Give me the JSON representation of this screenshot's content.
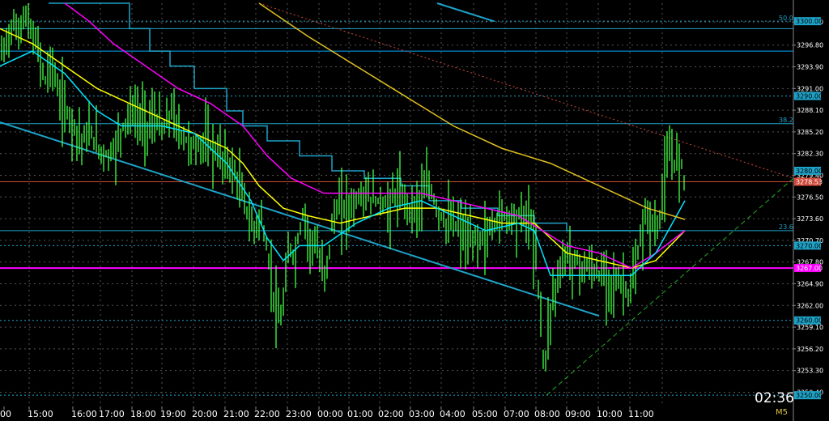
{
  "window": {
    "timeframe": "M5",
    "countdown": "02:36"
  },
  "chart_data": {
    "type": "candlestick",
    "timeframe": "M5",
    "ylim": [
      3248.5,
      3302.4
    ],
    "y_ticks": [
      "3299.90",
      "3296.80",
      "3293.90",
      "3291.00",
      "3288.10",
      "3285.20",
      "3282.30",
      "3279.40",
      "3276.50",
      "3273.60",
      "3270.70",
      "3267.80",
      "3264.90",
      "3262.00",
      "3259.10",
      "3256.20",
      "3253.30",
      "3250.40"
    ],
    "x_ticks": [
      "00",
      "15:00",
      "16:00",
      "17:00",
      "18:00",
      "19:00",
      "20:00",
      "21:00",
      "22:00",
      "23:00",
      "00:00",
      "01:00",
      "02:00",
      "03:00",
      "04:00",
      "05:00",
      "07:00",
      "08:00",
      "09:00",
      "10:00",
      "11:00"
    ],
    "price_tags": [
      {
        "label": "3300.00",
        "value": 3300.0,
        "color": "#1ea3c8"
      },
      {
        "label": "3290.00",
        "value": 3290.0,
        "color": "#1ea3c8"
      },
      {
        "label": "3280.00",
        "value": 3280.0,
        "color": "#1ea3c8"
      },
      {
        "label": "3278.53",
        "value": 3278.53,
        "color": "#d04a3a"
      },
      {
        "label": "3270.00",
        "value": 3270.0,
        "color": "#1ea3c8"
      },
      {
        "label": "3267.00",
        "value": 3267.0,
        "color": "#ff00ff"
      },
      {
        "label": "3260.00",
        "value": 3260.0,
        "color": "#1ea3c8"
      },
      {
        "label": "3250.00",
        "value": 3250.0,
        "color": "#1ea3c8"
      }
    ],
    "fib_labels": [
      {
        "label": "50.0",
        "value": 3299.9
      },
      {
        "label": "38.2",
        "value": 3286.3
      },
      {
        "label": "23.6",
        "value": 3272.0
      }
    ],
    "horizontal_lines": [
      {
        "value": 3300.0,
        "color": "#1ea3c8",
        "style": "dotted"
      },
      {
        "value": 3299.0,
        "color": "#1ea3c8",
        "style": "solid"
      },
      {
        "value": 3296.0,
        "color": "#00aaff",
        "style": "solid"
      },
      {
        "value": 3290.0,
        "color": "#1ea3c8",
        "style": "dotted"
      },
      {
        "value": 3286.3,
        "color": "#1ea3c8",
        "style": "solid"
      },
      {
        "value": 3278.53,
        "color": "#d04a3a",
        "style": "solid"
      },
      {
        "value": 3272.0,
        "color": "#1ea3c8",
        "style": "solid"
      },
      {
        "value": 3270.0,
        "color": "#1ea3c8",
        "style": "dotted"
      },
      {
        "value": 3267.0,
        "color": "#ff00ff",
        "style": "solid"
      },
      {
        "value": 3260.0,
        "color": "#1ea3c8",
        "style": "dotted"
      },
      {
        "value": 3250.0,
        "color": "#1ea3c8",
        "style": "dotted"
      }
    ],
    "price_path": [
      [
        0,
        3295
      ],
      [
        8,
        3297
      ],
      [
        15,
        3300
      ],
      [
        22,
        3298
      ],
      [
        30,
        3301
      ],
      [
        40,
        3298
      ],
      [
        48,
        3296
      ],
      [
        56,
        3292
      ],
      [
        64,
        3295
      ],
      [
        72,
        3290
      ],
      [
        82,
        3288
      ],
      [
        92,
        3286
      ],
      [
        102,
        3284
      ],
      [
        112,
        3285
      ],
      [
        122,
        3283
      ],
      [
        132,
        3282
      ],
      [
        142,
        3283
      ],
      [
        152,
        3286
      ],
      [
        162,
        3288
      ],
      [
        172,
        3287
      ],
      [
        182,
        3286
      ],
      [
        192,
        3287
      ],
      [
        202,
        3285
      ],
      [
        212,
        3288
      ],
      [
        222,
        3285
      ],
      [
        232,
        3284
      ],
      [
        242,
        3283
      ],
      [
        252,
        3284
      ],
      [
        262,
        3283
      ],
      [
        272,
        3282
      ],
      [
        282,
        3281
      ],
      [
        292,
        3279
      ],
      [
        302,
        3276
      ],
      [
        312,
        3272
      ],
      [
        322,
        3274
      ],
      [
        332,
        3268
      ],
      [
        340,
        3262
      ],
      [
        346,
        3259
      ],
      [
        352,
        3264
      ],
      [
        358,
        3270
      ],
      [
        364,
        3268
      ],
      [
        370,
        3272
      ],
      [
        376,
        3275
      ],
      [
        382,
        3270
      ],
      [
        388,
        3271
      ],
      [
        394,
        3268
      ],
      [
        400,
        3266
      ],
      [
        406,
        3269
      ],
      [
        412,
        3274
      ],
      [
        420,
        3275
      ],
      [
        430,
        3275
      ],
      [
        440,
        3276
      ],
      [
        450,
        3277
      ],
      [
        460,
        3276
      ],
      [
        470,
        3276
      ],
      [
        480,
        3275
      ],
      [
        490,
        3277
      ],
      [
        500,
        3276
      ],
      [
        510,
        3275
      ],
      [
        520,
        3276
      ],
      [
        530,
        3278
      ],
      [
        540,
        3275
      ],
      [
        550,
        3273
      ],
      [
        560,
        3273
      ],
      [
        570,
        3272
      ],
      [
        580,
        3270
      ],
      [
        590,
        3271
      ],
      [
        600,
        3271
      ],
      [
        610,
        3273
      ],
      [
        620,
        3274
      ],
      [
        630,
        3274
      ],
      [
        640,
        3274
      ],
      [
        650,
        3274
      ],
      [
        656,
        3273
      ],
      [
        662,
        3268
      ],
      [
        668,
        3262
      ],
      [
        672,
        3252
      ],
      [
        676,
        3258
      ],
      [
        682,
        3263
      ],
      [
        690,
        3266
      ],
      [
        700,
        3269
      ],
      [
        710,
        3268
      ],
      [
        720,
        3267
      ],
      [
        730,
        3267
      ],
      [
        740,
        3266
      ],
      [
        750,
        3266
      ],
      [
        760,
        3265
      ],
      [
        770,
        3265
      ],
      [
        778,
        3263
      ],
      [
        784,
        3266
      ],
      [
        790,
        3270
      ],
      [
        798,
        3274
      ],
      [
        806,
        3273
      ],
      [
        812,
        3272
      ],
      [
        818,
        3276
      ],
      [
        822,
        3280
      ],
      [
        828,
        3282
      ],
      [
        834,
        3281
      ],
      [
        840,
        3282
      ],
      [
        846,
        3278.5
      ]
    ],
    "moving_averages": [
      {
        "color": "#ffff00",
        "points": [
          [
            0,
            3299
          ],
          [
            40,
            3297
          ],
          [
            80,
            3294
          ],
          [
            120,
            3291
          ],
          [
            160,
            3289
          ],
          [
            200,
            3287
          ],
          [
            240,
            3285
          ],
          [
            280,
            3283
          ],
          [
            300,
            3281
          ],
          [
            320,
            3278
          ],
          [
            350,
            3275
          ],
          [
            380,
            3274
          ],
          [
            420,
            3273
          ],
          [
            460,
            3274
          ],
          [
            500,
            3275
          ],
          [
            540,
            3275
          ],
          [
            580,
            3274
          ],
          [
            620,
            3273
          ],
          [
            660,
            3273
          ],
          [
            700,
            3269
          ],
          [
            740,
            3268
          ],
          [
            780,
            3267
          ],
          [
            810,
            3268
          ],
          [
            846,
            3272
          ]
        ]
      },
      {
        "color": "#ff00ff",
        "points": [
          [
            80,
            3302.4
          ],
          [
            110,
            3300
          ],
          [
            140,
            3297
          ],
          [
            180,
            3294
          ],
          [
            220,
            3291
          ],
          [
            260,
            3289
          ],
          [
            300,
            3286
          ],
          [
            330,
            3282
          ],
          [
            360,
            3279
          ],
          [
            400,
            3277
          ],
          [
            440,
            3277
          ],
          [
            480,
            3277
          ],
          [
            520,
            3277
          ],
          [
            560,
            3276
          ],
          [
            600,
            3275
          ],
          [
            640,
            3274
          ],
          [
            670,
            3272
          ],
          [
            700,
            3270
          ],
          [
            740,
            3269
          ],
          [
            780,
            3267
          ],
          [
            810,
            3269
          ],
          [
            846,
            3272
          ]
        ]
      },
      {
        "color": "#00e5ff",
        "points": [
          [
            0,
            3294
          ],
          [
            40,
            3296
          ],
          [
            80,
            3293
          ],
          [
            120,
            3288
          ],
          [
            150,
            3286
          ],
          [
            200,
            3286
          ],
          [
            240,
            3285
          ],
          [
            280,
            3281
          ],
          [
            310,
            3276
          ],
          [
            330,
            3271
          ],
          [
            350,
            3268
          ],
          [
            370,
            3270
          ],
          [
            400,
            3270
          ],
          [
            440,
            3273
          ],
          [
            480,
            3275
          ],
          [
            520,
            3276
          ],
          [
            560,
            3274
          ],
          [
            600,
            3272
          ],
          [
            640,
            3273
          ],
          [
            660,
            3272
          ],
          [
            680,
            3266
          ],
          [
            700,
            3266
          ],
          [
            740,
            3266
          ],
          [
            780,
            3266
          ],
          [
            810,
            3269
          ],
          [
            846,
            3276
          ]
        ]
      },
      {
        "color": "#e0c020",
        "points": [
          [
            320,
            3302.4
          ],
          [
            380,
            3298
          ],
          [
            440,
            3294
          ],
          [
            500,
            3290
          ],
          [
            560,
            3286
          ],
          [
            620,
            3283
          ],
          [
            680,
            3281
          ],
          [
            740,
            3278
          ],
          [
            800,
            3275
          ],
          [
            846,
            3273.5
          ]
        ]
      }
    ],
    "step_line": {
      "color": "#1ea3c8",
      "points": [
        [
          60,
          3302.4
        ],
        [
          160,
          3302.4
        ],
        [
          160,
          3299
        ],
        [
          185,
          3299
        ],
        [
          185,
          3296
        ],
        [
          210,
          3296
        ],
        [
          210,
          3294
        ],
        [
          240,
          3294
        ],
        [
          240,
          3291
        ],
        [
          280,
          3291
        ],
        [
          280,
          3288
        ],
        [
          300,
          3288
        ],
        [
          300,
          3286
        ],
        [
          330,
          3286
        ],
        [
          330,
          3284
        ],
        [
          370,
          3284
        ],
        [
          370,
          3282
        ],
        [
          410,
          3282
        ],
        [
          410,
          3280
        ],
        [
          450,
          3280
        ],
        [
          450,
          3279
        ],
        [
          495,
          3279
        ],
        [
          495,
          3278
        ],
        [
          530,
          3278
        ],
        [
          530,
          3276
        ],
        [
          570,
          3276
        ],
        [
          570,
          3275
        ],
        [
          615,
          3275
        ],
        [
          615,
          3274
        ],
        [
          660,
          3274
        ],
        [
          660,
          3273
        ],
        [
          700,
          3273
        ],
        [
          700,
          3272
        ],
        [
          780,
          3272
        ],
        [
          780,
          3272
        ],
        [
          846,
          3272
        ]
      ]
    },
    "trend_lines": [
      {
        "color": "#1ea3c8",
        "style": "solid",
        "from": [
          0,
          3286.5
        ],
        "to": [
          740,
          3260.6
        ]
      },
      {
        "color": "#1ea3c8",
        "style": "solid",
        "from": [
          540,
          3302.4
        ],
        "to": [
          610,
          3300.0
        ]
      },
      {
        "color": "#d04a3a",
        "style": "dotted",
        "from": [
          320,
          3302.4
        ],
        "to": [
          980,
          3279.0
        ]
      },
      {
        "color": "#22aa22",
        "style": "dashed",
        "from": [
          675,
          3250.0
        ],
        "to": [
          980,
          3279.0
        ]
      }
    ]
  }
}
